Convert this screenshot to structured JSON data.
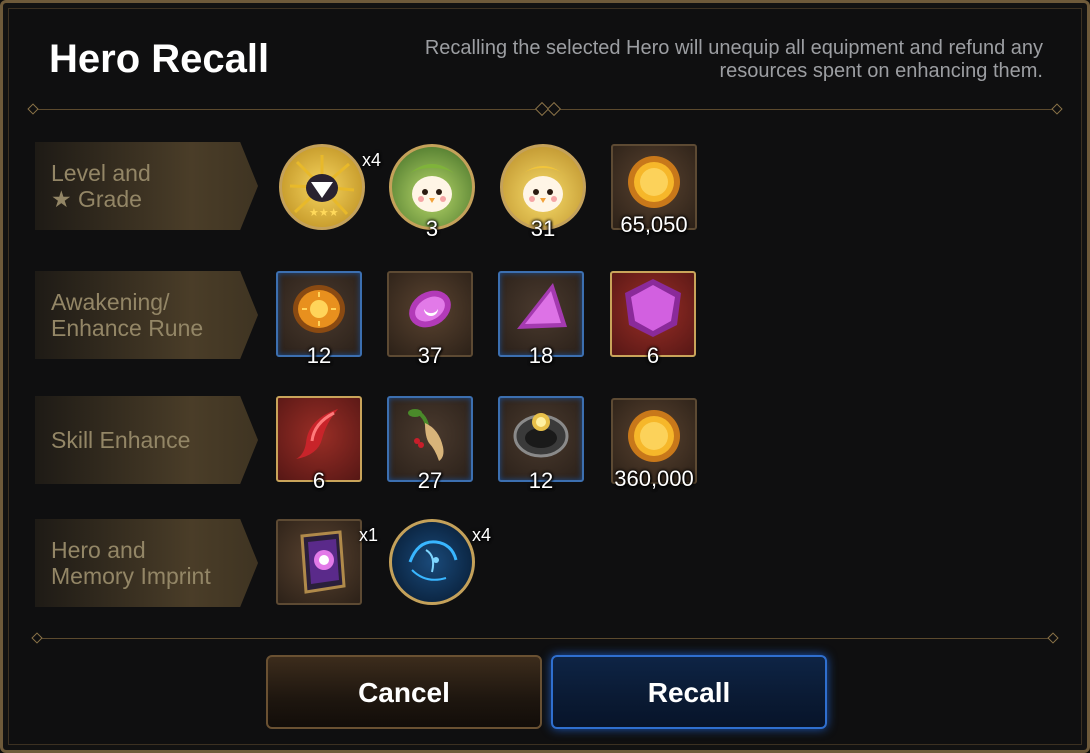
{
  "dialog": {
    "title": "Hero Recall",
    "description": "Recalling the selected Hero will unequip all equipment and refund any resources spent on enhancing them."
  },
  "rows": [
    {
      "label_line1": "Level and",
      "label_line2": "★ Grade",
      "items": [
        {
          "icon": "star-penguin-icon",
          "multiplier": "x4"
        },
        {
          "icon": "green-penguin-icon",
          "quantity": "3"
        },
        {
          "icon": "yellow-penguin-icon",
          "quantity": "31"
        },
        {
          "icon": "gold-coin-icon",
          "quantity": "65,050"
        }
      ]
    },
    {
      "label_line1": "Awakening/",
      "label_line2": "Enhance Rune",
      "items": [
        {
          "icon": "sun-rune-icon",
          "quantity": "12"
        },
        {
          "icon": "moon-rune-small-icon",
          "quantity": "37"
        },
        {
          "icon": "moon-rune-medium-icon",
          "quantity": "18"
        },
        {
          "icon": "moon-rune-large-icon",
          "quantity": "6"
        }
      ]
    },
    {
      "label_line1": "Skill Enhance",
      "label_line2": "",
      "items": [
        {
          "icon": "red-horn-icon",
          "quantity": "6"
        },
        {
          "icon": "ginseng-icon",
          "quantity": "27"
        },
        {
          "icon": "sun-ring-icon",
          "quantity": "12"
        },
        {
          "icon": "gold-coin-icon",
          "quantity": "360,000"
        }
      ]
    },
    {
      "label_line1": "Hero and",
      "label_line2": "Memory Imprint",
      "items": [
        {
          "icon": "hero-card-icon",
          "multiplier": "x1"
        },
        {
          "icon": "memory-imprint-icon",
          "multiplier": "x4"
        }
      ]
    }
  ],
  "buttons": {
    "cancel": "Cancel",
    "recall": "Recall"
  },
  "colors": {
    "frame": "#6e5a3a",
    "label_text": "#938666",
    "recall_border": "#2f6fcf"
  }
}
